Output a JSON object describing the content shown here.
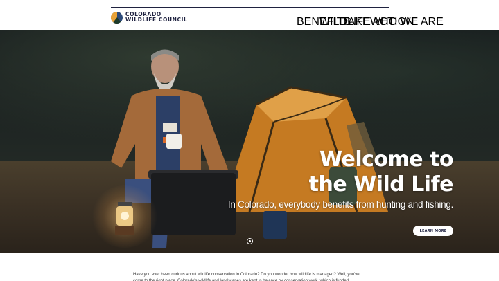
{
  "header": {
    "logo_line1": "COLORADO",
    "logo_line2": "WILDLIFE COUNCIL",
    "nav": [
      "BENEFITS",
      "WILDLIFE",
      "TAKE ACTION",
      "WHO WE ARE"
    ]
  },
  "hero": {
    "title_line1": "Welcome to",
    "title_line2": "the Wild Life",
    "subtitle": "In Colorado, everybody benefits from hunting and fishing.",
    "button": "LEARN MORE"
  },
  "intro": {
    "text": "Have you ever been curious about wildlife conservation in Colorado? Do you wonder how wildlife is managed? Well, you've come to the right place. Colorado's wildlife and landscapes are kept in balance by conservation work, which is funded"
  },
  "colors": {
    "navy": "#1f2240",
    "tent_orange": "#d98a2b",
    "white": "#ffffff"
  }
}
